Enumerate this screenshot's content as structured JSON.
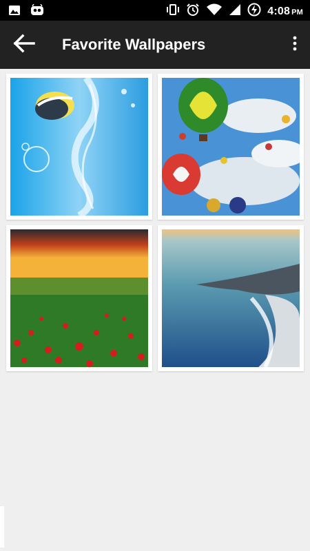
{
  "status_bar": {
    "time": "4:08",
    "ampm": "PM",
    "left_icons": [
      "image-icon",
      "app-notification-icon"
    ],
    "right_icons": [
      "vibrate-icon",
      "alarm-icon",
      "wifi-icon",
      "signal-icon",
      "battery-charging-icon"
    ]
  },
  "app_bar": {
    "title": "Favorite Wallpapers",
    "back_icon": "arrow-back-icon",
    "menu_icon": "more-vertical-icon"
  },
  "wallpapers": [
    {
      "subject": "fish and water splash",
      "accent": "#1ea7e6"
    },
    {
      "subject": "hot air balloons in cloudy sky",
      "accent": "#3f8fd8"
    },
    {
      "subject": "poppy field at sunset",
      "accent": "#2f8a2a"
    },
    {
      "subject": "ocean shoreline",
      "accent": "#2e6f99"
    }
  ]
}
